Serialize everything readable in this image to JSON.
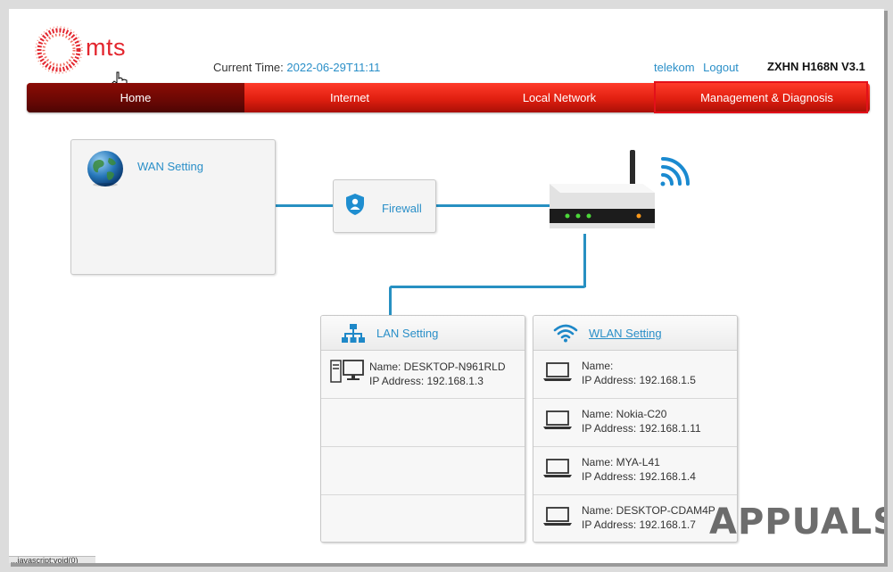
{
  "header": {
    "brand": "mts",
    "current_time_label": "Current Time:",
    "current_time_value": "2022-06-29T11:11",
    "links": [
      "telekom",
      "Logout"
    ],
    "model": "ZXHN H168N V3.1"
  },
  "nav": {
    "items": [
      {
        "label": "Home",
        "active": true
      },
      {
        "label": "Internet",
        "active": false
      },
      {
        "label": "Local Network",
        "active": false
      },
      {
        "label": "Management & Diagnosis",
        "active": false,
        "highlighted": true
      }
    ],
    "highlight_color": "#e3101a"
  },
  "wan": {
    "label": "WAN Setting"
  },
  "firewall": {
    "label": "Firewall"
  },
  "lan": {
    "title": "LAN Setting",
    "devices": [
      {
        "name": "Name: DESKTOP-N961RLD",
        "ip": "IP Address: 192.168.1.3"
      }
    ]
  },
  "wlan": {
    "title": "WLAN Setting",
    "devices": [
      {
        "name": "Name:",
        "ip": "IP Address: 192.168.1.5"
      },
      {
        "name": "Name: Nokia-C20",
        "ip": "IP Address: 192.168.1.11"
      },
      {
        "name": "Name: MYA-L41",
        "ip": "IP Address: 192.168.1.4"
      },
      {
        "name": "Name: DESKTOP-CDAM4P",
        "ip": "IP Address: 192.168.1.7"
      }
    ]
  },
  "watermark": "APPUALS",
  "status_text": "...javascript:void(0)",
  "colors": {
    "accent": "#2a8fc8",
    "nav_red": "#e01f10",
    "nav_active": "#6a0804",
    "brand": "#e3262e"
  }
}
